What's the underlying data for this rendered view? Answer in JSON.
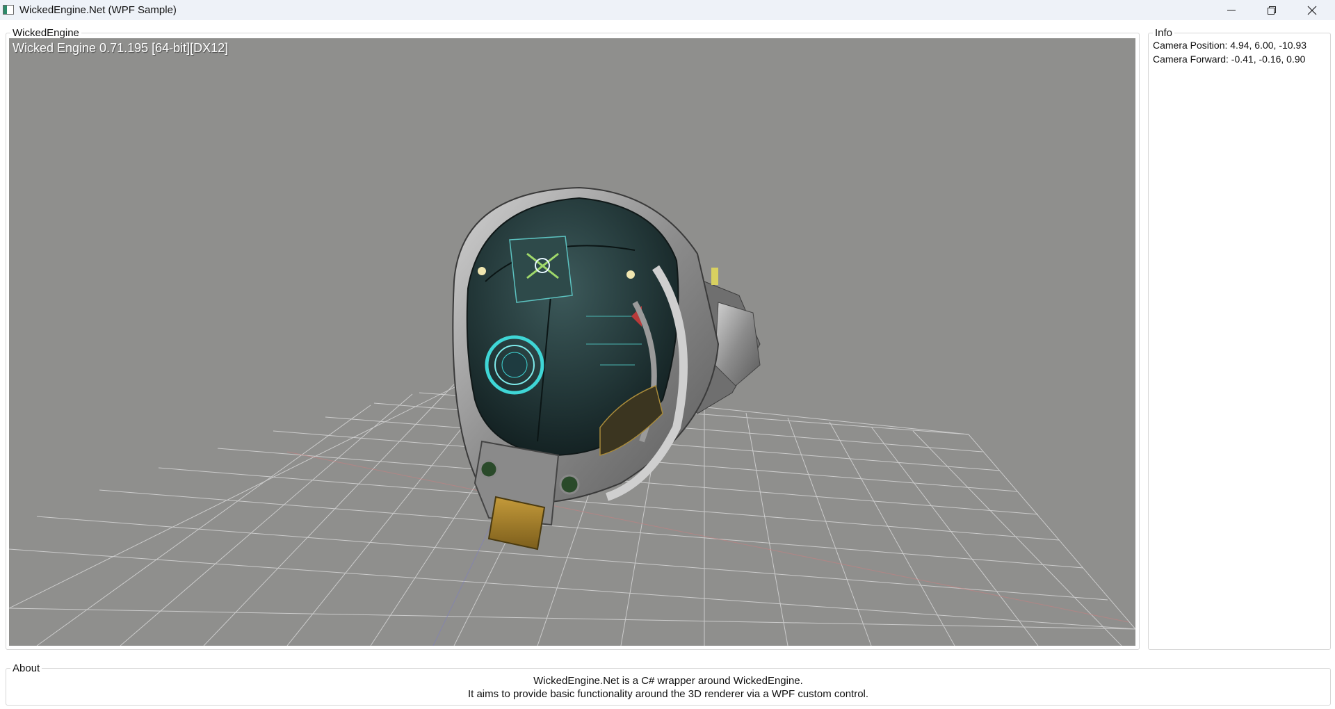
{
  "window": {
    "title": "WickedEngine.Net (WPF Sample)",
    "controls": [
      "minimize-icon",
      "restore-icon",
      "close-icon"
    ]
  },
  "viewport_group": {
    "header": "WickedEngine",
    "engine_label": "Wicked Engine 0.71.195 [64-bit][DX12]"
  },
  "info_group": {
    "header": "Info",
    "camera_position": "Camera Position: 4.94,  6.00,  -10.93",
    "camera_forward": "Camera Forward: -0.41,  -0.16,  0.90"
  },
  "about_group": {
    "header": "About",
    "line1": "WickedEngine.Net is a C# wrapper around WickedEngine.",
    "line2": "It aims to provide basic functionality around the 3D renderer via a WPF custom control."
  },
  "colors": {
    "titlebar_bg": "#eef2f8",
    "viewport_bg": "#8f8f8d",
    "grid": "#d9d9d9",
    "helmet_dark": "#25393a",
    "hud_cyan": "#3fd6d6",
    "metal": "#a8a8a8",
    "brass": "#b08a2c"
  }
}
